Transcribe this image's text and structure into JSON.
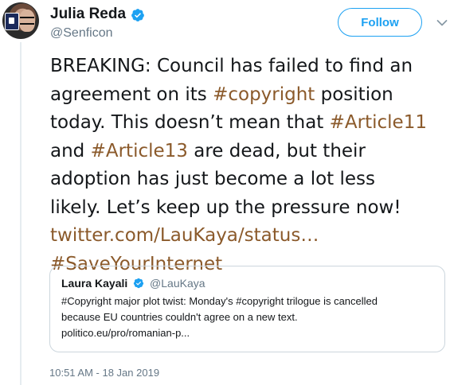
{
  "user": {
    "display_name": "Julia Reda",
    "username": "@Senficon"
  },
  "follow_button": {
    "label": "Follow"
  },
  "tweet": {
    "line1": "BREAKING: Council has failed to find an",
    "line2_pre": "agreement on its ",
    "line2_hashtag": "#copyright",
    "line2_post": " position",
    "line3_pre": "today. This doesn’t mean that ",
    "line3_hashtag": "#Article11",
    "line4_pre": "and ",
    "line4_hashtag": "#Article13",
    "line4_post": " are dead, but their",
    "line5": "adoption has just become a lot less",
    "line6": "likely. Let’s keep up the pressure now!",
    "link": "twitter.com/LauKaya/status…",
    "hashtag_final": "#SaveYourInternet"
  },
  "quoted_tweet": {
    "display_name": "Laura Kayali",
    "username": "@LauKaya",
    "line1": "#Copyright major plot twist: Monday's #copyright trilogue is cancelled",
    "line2": "because EU countries couldn't agree on a new text.",
    "line3": "politico.eu/pro/romanian-p..."
  },
  "timestamp": "10:51 AM - 18 Jan 2019",
  "colors": {
    "link": "#8b5a2b",
    "follow_blue": "#1da1f2",
    "secondary_text": "#657786",
    "border": "#ccd6dd"
  },
  "icons": {
    "verified": "verified-badge-icon",
    "menu": "chevron-down-icon"
  }
}
